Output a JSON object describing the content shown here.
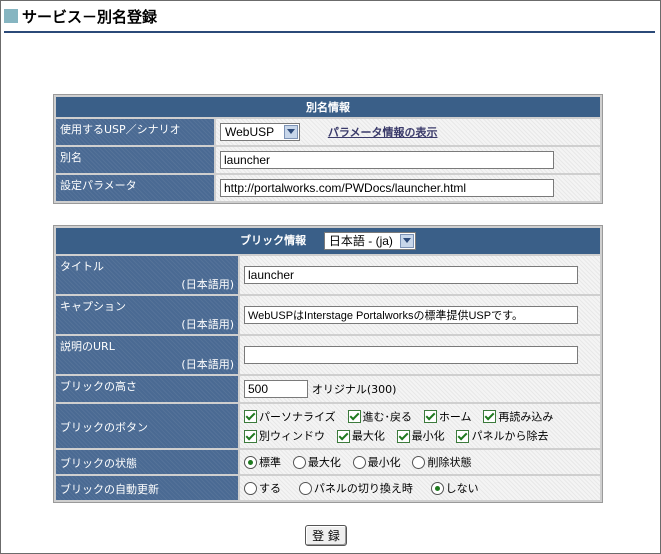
{
  "page": {
    "title": "サービス－別名登録"
  },
  "alias": {
    "header": "別名情報",
    "usp_label": "使用するUSP／シナリオ",
    "usp_selected": "WebUSP",
    "param_link": "パラメータ情報の表示",
    "alias_label": "別名",
    "alias_value": "launcher",
    "param_label": "設定パラメータ",
    "param_value": "http://portalworks.com/PWDocs/launcher.html"
  },
  "brick": {
    "header": "ブリック情報",
    "lang_selected": "日本語 - (ja)",
    "lang_note": "(日本語用)",
    "title_label": "タイトル",
    "title_value": "launcher",
    "caption_label": "キャプション",
    "caption_value": "WebUSPはInterstage Portalworksの標準提供USPです。",
    "url_label": "説明のURL",
    "url_value": "",
    "height_label": "ブリックの高さ",
    "height_value": "500",
    "height_original": "オリジナル(300)",
    "buttons_label": "ブリックのボタン",
    "buttons": [
      "パーソナライズ",
      "進む･戻る",
      "ホーム",
      "再読み込み",
      "別ウィンドウ",
      "最大化",
      "最小化",
      "パネルから除去"
    ],
    "state_label": "ブリックの状態",
    "states": [
      "標準",
      "最大化",
      "最小化",
      "削除状態"
    ],
    "state_selected": "標準",
    "refresh_label": "ブリックの自動更新",
    "refresh_options": [
      "する",
      "パネルの切り換え時",
      "しない"
    ],
    "refresh_selected": "しない"
  },
  "submit_label": "登 録",
  "colors": {
    "header_bg": "#3a5f88",
    "label_bg": "#4a6a93",
    "accent_square": "#86b5c1",
    "rule": "#2b4a78"
  }
}
